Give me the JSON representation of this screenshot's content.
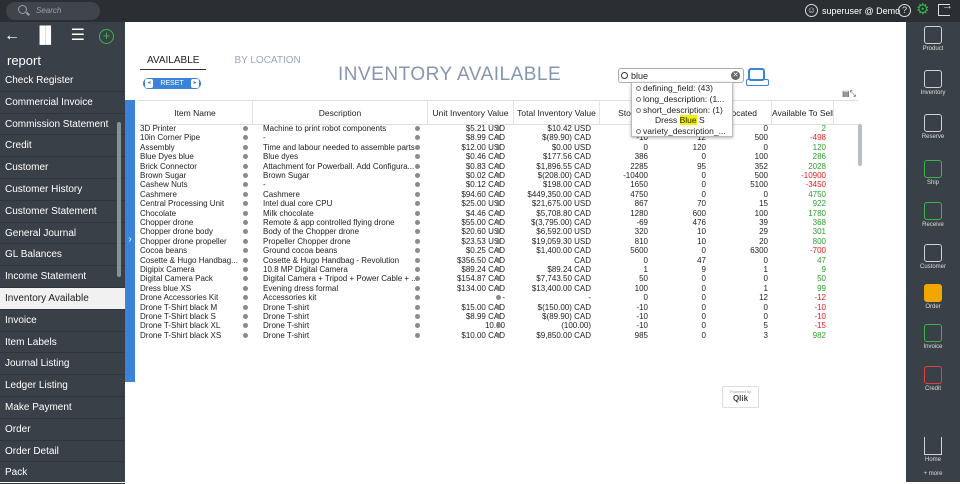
{
  "topbar": {
    "search_placeholder": "Search",
    "user": "superuser @ Demo"
  },
  "left_nav": {
    "heading": "report",
    "items": [
      "Check Register",
      "Commercial Invoice",
      "Commission Statement",
      "Credit",
      "Customer",
      "Customer History",
      "Customer Statement",
      "General Journal",
      "GL Balances",
      "Income Statement",
      "Inventory Available",
      "Invoice",
      "Item Labels",
      "Journal Listing",
      "Ledger Listing",
      "Make Payment",
      "Order",
      "Order Detail",
      "Pack"
    ],
    "selected": "Inventory Available"
  },
  "right_nav": {
    "items": [
      "Product",
      "Inventory",
      "Reserve",
      "Ship",
      "Receive",
      "Customer",
      "Order",
      "Invoice",
      "Credit",
      "Home"
    ],
    "more": "+ more"
  },
  "tabs": [
    "AVAILABLE",
    "BY LOCATION"
  ],
  "reset_label": "RESET",
  "title": "INVENTORY AVAILABLE",
  "search_value": "blue",
  "popup": {
    "items": [
      "defining_field: (43)",
      "long_description: (1...",
      "short_description: (1)"
    ],
    "sub_pre": "Dress ",
    "sub_hl": "Blue",
    "sub_post": " S",
    "last": "variety_description_..."
  },
  "columns": [
    "Item Name",
    "Description",
    "Unit Inventory Value",
    "Total Inventory Value",
    "Sto",
    "",
    "Allocated",
    "Available To Sell"
  ],
  "rows": [
    [
      "3D Printer",
      "Machine to print robot components",
      "$5.21 USD",
      "$10.42 USD",
      "",
      "",
      "0",
      "2"
    ],
    [
      "10in Corner Pipe",
      "-",
      "$8.99 CAD",
      "$(89.90) CAD",
      "-10",
      "12",
      "500",
      "-498"
    ],
    [
      "Assembly",
      "Time and labour needed to assemble parts",
      "$12.00 USD",
      "$0.00 USD",
      "0",
      "120",
      "0",
      "120"
    ],
    [
      "Blue Dyes blue",
      "Blue dyes",
      "$0.46 CAD",
      "$177.56 CAD",
      "386",
      "0",
      "100",
      "286"
    ],
    [
      "Brick Connector",
      "Attachment for Powerball. Add Configura...",
      "$0.83 CAD",
      "$1,896.55 CAD",
      "2285",
      "95",
      "352",
      "2028"
    ],
    [
      "Brown Sugar",
      "Brown Sugar",
      "$0.02 CAD",
      "$(208.00) CAD",
      "-10400",
      "0",
      "500",
      "-10900"
    ],
    [
      "Cashew Nuts",
      "-",
      "$0.12 CAD",
      "$198.00 CAD",
      "1650",
      "0",
      "5100",
      "-3450"
    ],
    [
      "Cashmere",
      "Cashmere",
      "$94.60 CAD",
      "$449,350.00 CAD",
      "4750",
      "0",
      "0",
      "4750"
    ],
    [
      "Central Processing Unit",
      "Intel dual core CPU",
      "$25.00 USD",
      "$21,675.00 USD",
      "867",
      "70",
      "15",
      "922"
    ],
    [
      "Chocolate",
      "Milk chocolate",
      "$4.46 CAD",
      "$5,708.80 CAD",
      "1280",
      "600",
      "100",
      "1780"
    ],
    [
      "Chopper drone",
      "Remote & app controlled flying drone",
      "$55.00 CAD",
      "$(3,795.00) CAD",
      "-69",
      "476",
      "39",
      "368"
    ],
    [
      "Chopper drone body",
      "Body of the Chopper drone",
      "$20.60 USD",
      "$6,592.00 USD",
      "320",
      "10",
      "29",
      "301"
    ],
    [
      "Chopper drone propeller",
      "Propeller Chopper drone",
      "$23.53 USD",
      "$19,059.30 USD",
      "810",
      "10",
      "20",
      "800"
    ],
    [
      "Cocoa beans",
      "Ground cocoa beans",
      "$0.25 CAD",
      "$1,400.00 CAD",
      "5600",
      "0",
      "6300",
      "-700"
    ],
    [
      "Cosette & Hugo Handbag...",
      "Cosette & Hugo Handbag - Revolution",
      "$356.50 CAD",
      "CAD",
      "0",
      "47",
      "0",
      "47"
    ],
    [
      "Digipix Camera",
      "10.8 MP Digital Camera",
      "$89.24 CAD",
      "$89.24 CAD",
      "1",
      "9",
      "1",
      "9"
    ],
    [
      "Digital Camera Pack",
      "Digital Camera + Tripod + Power Cable + ...",
      "$154.87 CAD",
      "$7,743.50 CAD",
      "50",
      "0",
      "0",
      "50"
    ],
    [
      "Dress blue XS",
      "Evening dress formal",
      "$134.00 CAD",
      "$13,400.00 CAD",
      "100",
      "0",
      "1",
      "99"
    ],
    [
      "Drone Accessories Kit",
      "Accessories kit",
      "-",
      "-",
      "0",
      "0",
      "12",
      "-12"
    ],
    [
      "Drone T-Shirt black M",
      "Drone T-shirt",
      "$15.00 CAD",
      "$(150.00) CAD",
      "-10",
      "0",
      "0",
      "-10"
    ],
    [
      "Drone T-Shirt black S",
      "Drone T-shirt",
      "$8.99 CAD",
      "$(89.90) CAD",
      "-10",
      "0",
      "0",
      "-10"
    ],
    [
      "Drone T-Shirt black XL",
      "Drone T-shirt",
      "10.00",
      "(100.00)",
      "-10",
      "0",
      "5",
      "-15"
    ],
    [
      "Drone T-Shirt black XS",
      "Drone T-shirt",
      "$10.00 CAD",
      "$9,850.00 CAD",
      "985",
      "0",
      "3",
      "982"
    ]
  ],
  "qlik": {
    "powered": "Powered by",
    "brand": "Qlik"
  }
}
